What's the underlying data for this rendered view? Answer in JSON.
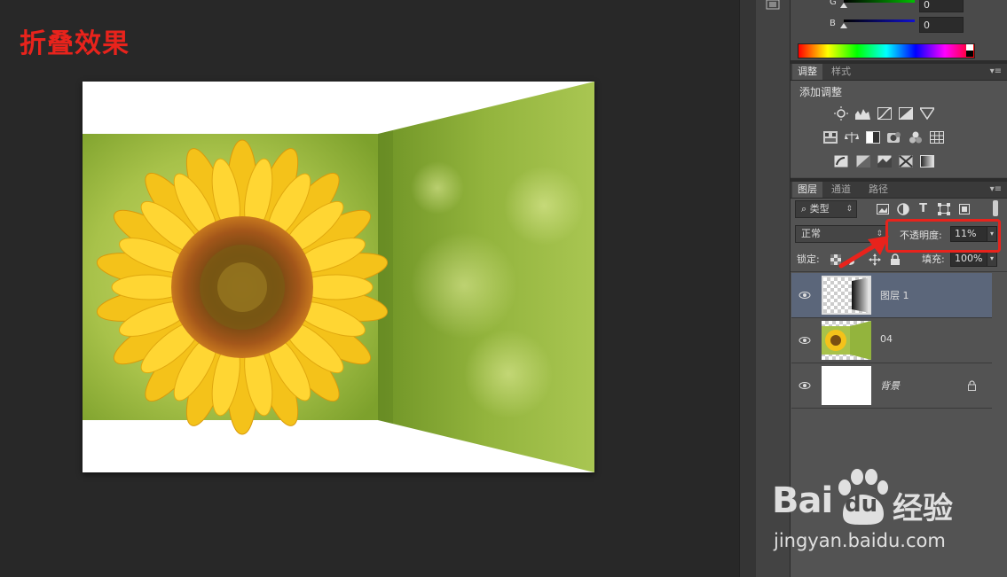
{
  "overlay_title": "折叠效果",
  "color_panel": {
    "g_label": "G",
    "g_value": "0",
    "b_label": "B",
    "b_value": "0"
  },
  "adjust_panel": {
    "tabs": [
      "调整",
      "样式"
    ],
    "heading": "添加调整"
  },
  "layers_panel": {
    "tabs": [
      "图层",
      "通道",
      "路径"
    ],
    "filter_kind": "类型",
    "blend_mode": "正常",
    "opacity_label": "不透明度:",
    "opacity_value": "11%",
    "lock_label": "锁定:",
    "fill_label": "填充:",
    "fill_value": "100%",
    "layers": [
      {
        "name": "图层 1",
        "selected": true
      },
      {
        "name": "04",
        "selected": false
      },
      {
        "name": "背景",
        "selected": false,
        "locked": true
      }
    ]
  },
  "watermark": {
    "brand_left": "Bai",
    "brand_right": "du",
    "brand_cn": "经验",
    "url": "jingyan.baidu.com"
  },
  "colors": {
    "annotation_red": "#e8231c",
    "selected_layer": "#5b667a"
  }
}
